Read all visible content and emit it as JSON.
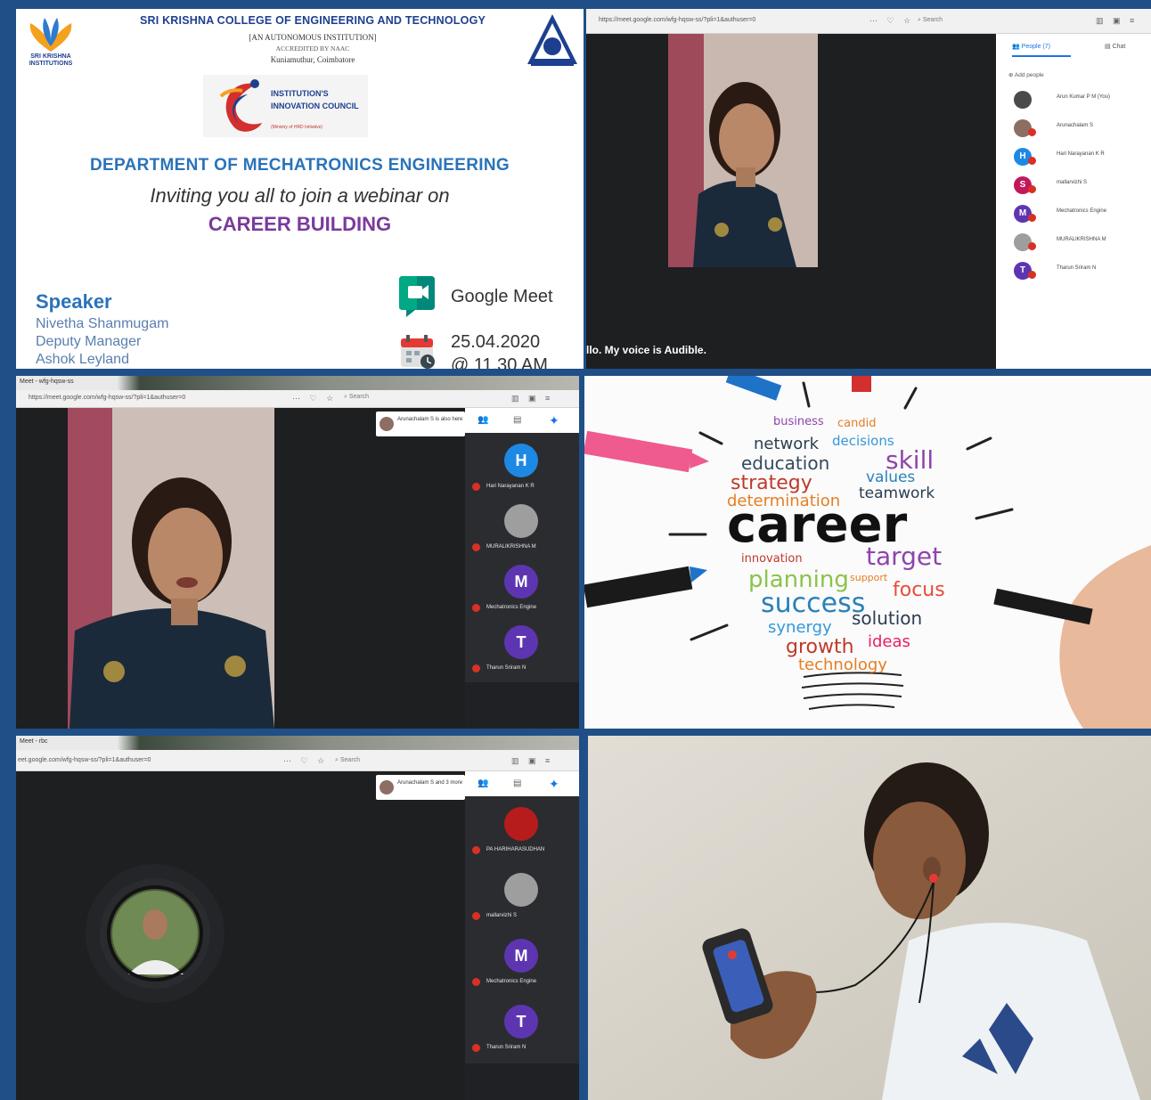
{
  "poster": {
    "logo_brand": "SRI KRISHNA INSTITUTIONS",
    "college_name": "SRI KRISHNA COLLEGE OF ENGINEERING AND TECHNOLOGY",
    "autonomous": "[AN AUTONOMOUS INSTITUTION]",
    "accreditation": "ACCREDITED BY NAAC",
    "city": "Kuniamuthur, Coimbatore",
    "iic_title": "INSTITUTION'S INNOVATION COUNCIL",
    "iic_subtitle": "(Ministry of HRD Initiative)",
    "department": "DEPARTMENT OF MECHATRONICS ENGINEERING",
    "invite": "Inviting you all to join a webinar on",
    "topic": "CAREER BUILDING",
    "speaker_heading": "Speaker",
    "speaker_name": "Nivetha Shanmugam",
    "speaker_role": "Deputy Manager",
    "speaker_company": "Ashok Leyland",
    "platform": "Google Meet",
    "date": "25.04.2020",
    "time": "@ 11.30 AM"
  },
  "meet1": {
    "url": "https://meet.google.com/wfg-hqsw-ss/?pli=1&authuser=0",
    "search": "Search",
    "tab_people": "People (7)",
    "tab_chat": "Chat",
    "add_people": "Add people",
    "caption": "llo. My voice is Audible.",
    "participants": [
      {
        "initial": "",
        "name": "Arun Kumar P M (You)",
        "color": "#4a4a4a"
      },
      {
        "initial": "",
        "name": "Arunachalam S",
        "color": "#8d6e63"
      },
      {
        "initial": "H",
        "name": "Hari Narayanan K R",
        "color": "#1e88e5"
      },
      {
        "initial": "S",
        "name": "mallarvizhi S",
        "color": "#c2185b"
      },
      {
        "initial": "M",
        "name": "Mechatronics Engine",
        "color": "#5e35b1"
      },
      {
        "initial": "",
        "name": "MURALIKRISHNA M",
        "color": "#9e9e9e"
      },
      {
        "initial": "T",
        "name": "Tharun Sriram N",
        "color": "#5e35b1"
      }
    ]
  },
  "meet2": {
    "tab_label": "Meet - wfg-hqsw-ss",
    "url": "https://meet.google.com/wfg-hqsw-ss/?pli=1&authuser=0",
    "search": "Search",
    "presence": "Arunachalam S is also here",
    "tiles": [
      {
        "initial": "H",
        "name": "Hari Narayanan K R",
        "color": "#1e88e5"
      },
      {
        "initial": "",
        "name": "MURALIKRISHNA M",
        "color": "#9e9e9e"
      },
      {
        "initial": "M",
        "name": "Mechatronics Engine",
        "color": "#5e35b1"
      },
      {
        "initial": "T",
        "name": "Tharun Sriram N",
        "color": "#5e35b1"
      }
    ]
  },
  "meet3": {
    "tab_label": "Meet - rbc",
    "url": "eet.google.com/wfg-hqsw-ss/?pli=1&authuser=0",
    "search": "Search",
    "presence": "Arunachalam S and 3 more",
    "tiles": [
      {
        "initial": "",
        "name": "PA HARIHARASUDHAN",
        "color": "#b71c1c"
      },
      {
        "initial": "",
        "name": "mallarvizhi S",
        "color": "#9e9e9e"
      },
      {
        "initial": "M",
        "name": "Mechatronics Engine",
        "color": "#5e35b1"
      },
      {
        "initial": "T",
        "name": "Tharun Sriram N",
        "color": "#5e35b1"
      }
    ]
  },
  "career": {
    "words": [
      "business",
      "candid",
      "network",
      "decisions",
      "education",
      "skill",
      "strategy",
      "values",
      "determination",
      "teamwork",
      "career",
      "innovation",
      "target",
      "planning",
      "support",
      "success",
      "focus",
      "synergy",
      "solution",
      "growth",
      "ideas",
      "technology"
    ]
  }
}
